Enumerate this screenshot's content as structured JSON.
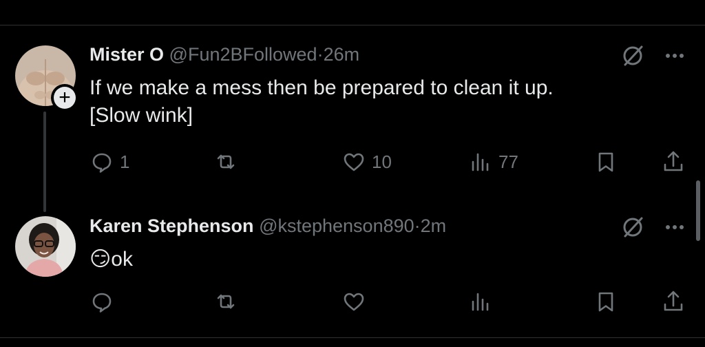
{
  "tweets": [
    {
      "display_name": "Mister O",
      "handle": "@Fun2BFollowed",
      "separator": "·",
      "time": "26m",
      "text_line1": "If we make a mess then be prepared to clean it up.",
      "text_line2": "[Slow wink]",
      "replies": "1",
      "reposts": "",
      "likes": "10",
      "views": "77"
    },
    {
      "display_name": "Karen Stephenson",
      "handle": "@kstephenson890",
      "separator": "·",
      "time": "2m",
      "emoji": "😏",
      "text": "ok",
      "replies": "",
      "reposts": "",
      "likes": "",
      "views": ""
    }
  ],
  "icons": {
    "reply": "reply-icon",
    "repost": "repost-icon",
    "like": "heart-icon",
    "views": "views-icon",
    "bookmark": "bookmark-icon",
    "share": "share-icon",
    "grok": "grok-icon",
    "more": "more-icon",
    "follow": "plus-icon"
  },
  "colors": {
    "background": "#000000",
    "text": "#e7e9ea",
    "muted": "#71767b",
    "divider": "#2f3336"
  }
}
